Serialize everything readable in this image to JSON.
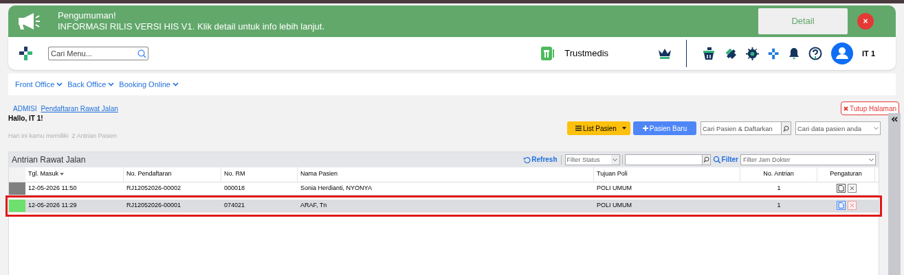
{
  "announcement": {
    "title": "Pengumuman!",
    "message": "INFORMASI RILIS VERSI HIS V1. Klik detail untuk info lebih lanjut.",
    "detail_button": "Detail",
    "close_button": "×"
  },
  "header": {
    "search": {
      "placeholder": "Cari Menu..."
    },
    "brand": "Trustmedis",
    "user": "IT 1"
  },
  "nav": [
    "Front Office",
    "Back Office",
    "Booking Online"
  ],
  "breadcrumb": [
    {
      "label": "ADMISI",
      "selected": false
    },
    {
      "label": "Pendaftaran Rawat Jalan",
      "selected": true
    }
  ],
  "close_page": "Tutup Halaman",
  "greeting": "Hallo, IT 1!",
  "queue_info": "Hari ini kamu memiliki  2 Antrian Pasien",
  "toolbar": {
    "list_button": "List Pasien",
    "new_button": "Pasien Baru",
    "search_register": {
      "placeholder": "Cari Pasien & Daftarkan"
    },
    "search_data": {
      "placeholder": "Cari data pasien anda"
    }
  },
  "panel": {
    "title": "Antrian Rawat Jalan",
    "refresh": "Refresh",
    "filter_status": {
      "placeholder": "Filter Status"
    },
    "filter": "Filter",
    "filter_doctor": {
      "placeholder": "Filter Jam Dokter"
    },
    "columns": [
      "Tgl. Masuk",
      "No. Pendaftaran",
      "No. RM",
      "Nama Pasien",
      "Tujuan Poli",
      "No. Antrian",
      "Pengaturan"
    ],
    "rows": [
      {
        "color": "#808080",
        "selected": false,
        "cells": [
          "12-05-2026 11:50",
          "RJ12052026-00002",
          "000018",
          "Sonia Herdianti, NYONYA",
          "POLI UMUM",
          "1"
        ]
      },
      {
        "color": "#6ee06e",
        "selected": true,
        "cells": [
          "12-05-2026 11:29",
          "RJ12052026-00001",
          "074021",
          "ARAF, Tn",
          "POLI UMUM",
          "1"
        ]
      }
    ]
  }
}
